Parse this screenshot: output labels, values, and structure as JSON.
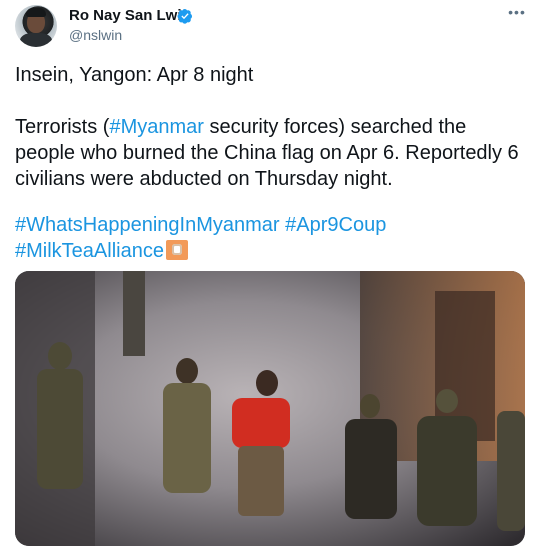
{
  "author": {
    "display_name": "Ro Nay San Lwin",
    "handle": "@nslwin"
  },
  "tweet": {
    "line1": "Insein, Yangon: Apr 8 night",
    "para2_prefix": "Terrorists (",
    "para2_hashtag": "#Myanmar",
    "para2_suffix": " security forces) searched the people who burned the China flag on Apr 6. Reportedly 6 civilians were abducted on Thursday night.",
    "hashtags": [
      "#WhatsHappeningInMyanmar",
      "#Apr9Coup",
      "#MilkTeaAlliance"
    ]
  },
  "icons": {
    "verified": "verified-badge-icon",
    "more": "more-options-icon",
    "emoji": "milk-tea-alliance-emoji"
  },
  "colors": {
    "accent": "#1b95e0",
    "text": "#0f1419",
    "secondary": "#5b7083"
  }
}
